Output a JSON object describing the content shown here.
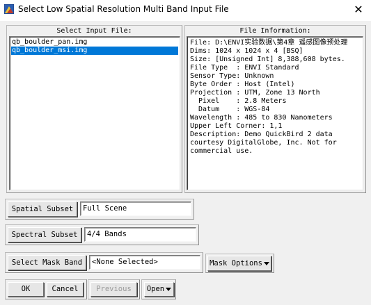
{
  "window": {
    "title": "Select Low Spatial Resolution Multi Band Input File",
    "close_glyph": "✕"
  },
  "input_panel": {
    "label": "Select Input File:",
    "files": [
      {
        "name": "qb_boulder_pan.img",
        "selected": false
      },
      {
        "name": "qb_boulder_msi.img",
        "selected": true
      }
    ]
  },
  "info_panel": {
    "label": "File Information:",
    "lines": [
      "File: D:\\ENVI实验数据\\第4章 遥感图像预处理",
      "Dims: 1024 x 1024 x 4 [BSQ]",
      "Size: [Unsigned Int] 8,388,608 bytes.",
      "File Type  : ENVI Standard",
      "Sensor Type: Unknown",
      "Byte Order : Host (Intel)",
      "Projection : UTM, Zone 13 North",
      "  Pixel    : 2.8 Meters",
      "  Datum    : WGS-84",
      "Wavelength : 485 to 830 Nanometers",
      "Upper Left Corner: 1,1",
      "Description: Demo QuickBird 2 data",
      "courtesy DigitalGlobe, Inc. Not for",
      "commercial use."
    ]
  },
  "spatial_subset": {
    "button": "Spatial Subset",
    "value": "Full Scene"
  },
  "spectral_subset": {
    "button": "Spectral Subset",
    "value": "4/4 Bands"
  },
  "mask": {
    "button": "Select Mask Band",
    "value": "<None Selected>",
    "options": "Mask Options"
  },
  "footer": {
    "ok": "OK",
    "cancel": "Cancel",
    "previous": "Previous",
    "open": "Open"
  },
  "icons": {
    "app": "envi-app-icon",
    "close": "close-icon"
  }
}
